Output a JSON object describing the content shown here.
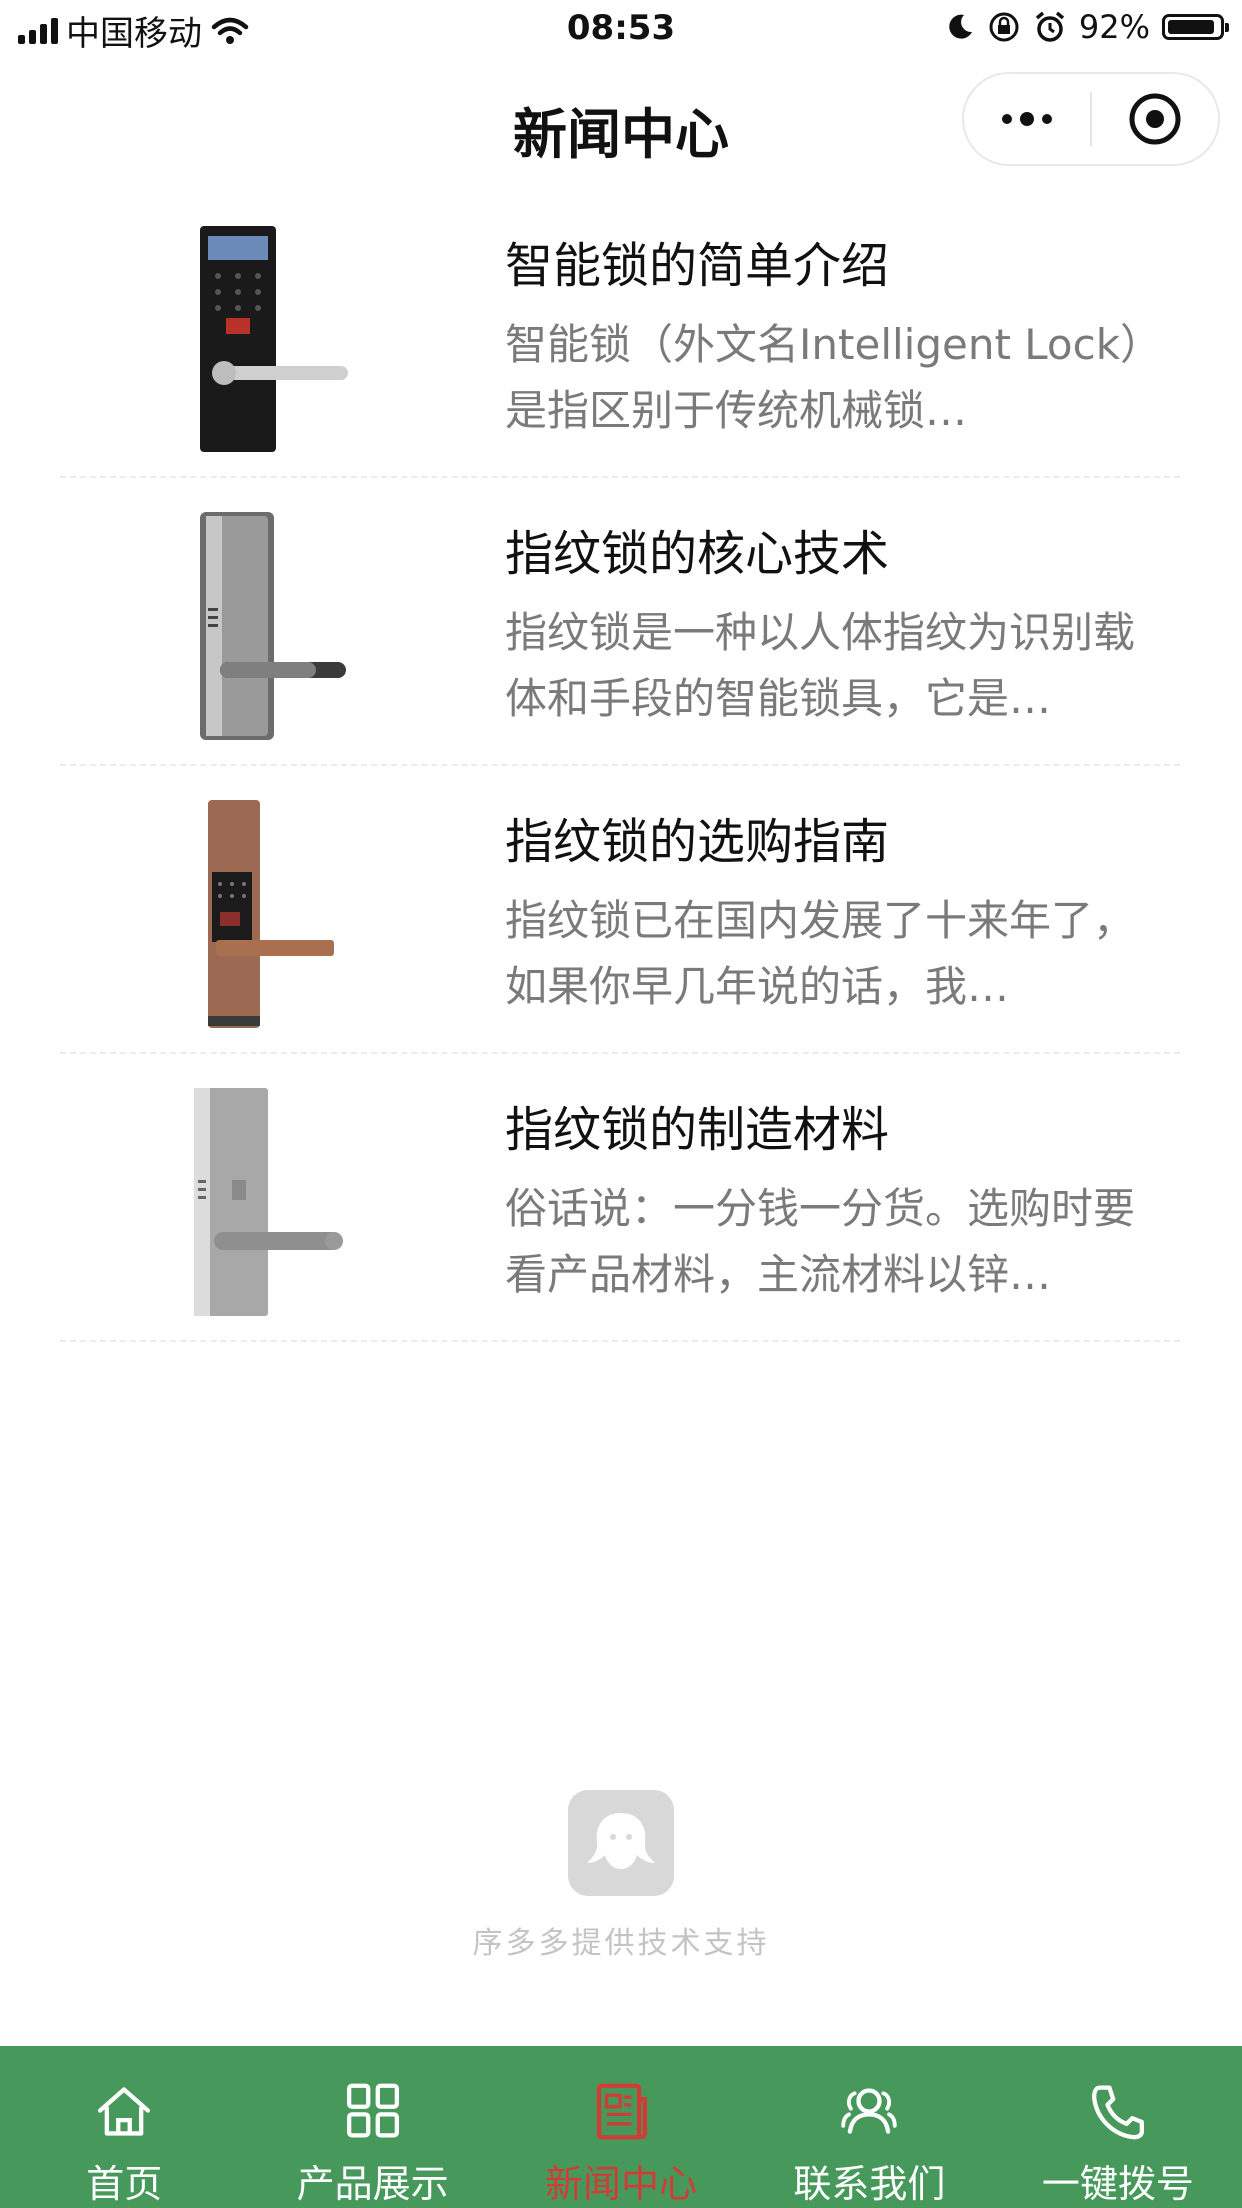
{
  "status_bar": {
    "carrier": "中国移动",
    "time": "08:53",
    "battery_percent": "92%",
    "battery_level": 0.92
  },
  "nav": {
    "title": "新闻中心"
  },
  "news": [
    {
      "title": "智能锁的简单介绍",
      "summary": "智能锁（外文名Intelligent Lock）是指区别于传统机械锁…"
    },
    {
      "title": "指纹锁的核心技术",
      "summary": "指纹锁是一种以人体指纹为识别载体和手段的智能锁具，它是…"
    },
    {
      "title": "指纹锁的选购指南",
      "summary": "指纹锁已在国内发展了十来年了，如果你早几年说的话，我…"
    },
    {
      "title": "指纹锁的制造材料",
      "summary": "俗话说：一分钱一分货。选购时要看产品材料，主流材料以锌…"
    }
  ],
  "support": {
    "text": "序多多提供技术支持"
  },
  "tabs": [
    {
      "label": "首页",
      "icon": "home-icon"
    },
    {
      "label": "产品展示",
      "icon": "grid-icon"
    },
    {
      "label": "新闻中心",
      "icon": "news-icon",
      "active": true
    },
    {
      "label": "联系我们",
      "icon": "contacts-icon"
    },
    {
      "label": "一键拨号",
      "icon": "phone-icon"
    }
  ],
  "colors": {
    "tab_bar": "#47995b",
    "tab_active": "#cf3e36",
    "tab_text": "#ffffff",
    "summary_text": "#7a7a7a"
  }
}
